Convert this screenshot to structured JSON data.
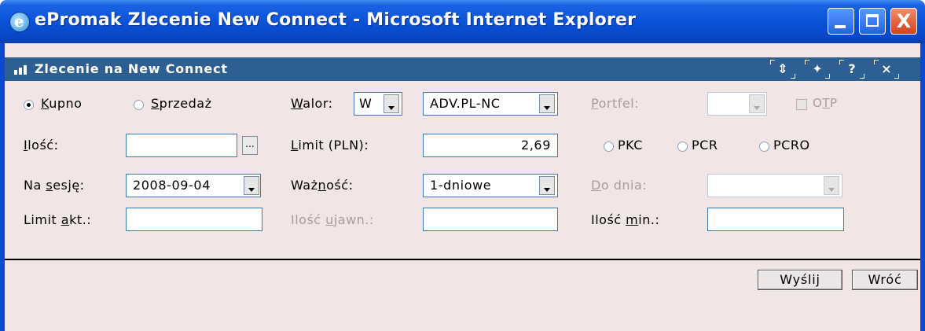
{
  "window": {
    "title": "ePromak Zlecenie New Connect - Microsoft Internet Explorer",
    "icon": "ie-icon",
    "controls": [
      "minimize-icon",
      "maximize-icon",
      "close-icon"
    ],
    "close_glyph": "X",
    "titlebar_color": "#0a52d8"
  },
  "panel": {
    "title": "Zlecenie na New Connect",
    "header_color": "#2d5f92",
    "background": "#f1e5e5",
    "header_buttons": [
      "⇕",
      "✦",
      "?",
      "×"
    ],
    "header_button_icons": [
      "resize-icon",
      "pin-icon",
      "help-icon",
      "close-icon"
    ]
  },
  "order": {
    "side_options": [
      {
        "pre": "",
        "key": "K",
        "post": "upno",
        "selected": true
      },
      {
        "pre": "",
        "key": "S",
        "post": "przedaż",
        "selected": false
      }
    ],
    "walor": {
      "label_key": "W",
      "label_rest": "alor:",
      "type_value": "W",
      "instrument": "ADV.PL-NC"
    },
    "portfel": {
      "label_key": "P",
      "label_rest": "ortfel:",
      "value": "",
      "disabled": true
    },
    "otp": {
      "pre": "O",
      "key": "T",
      "post": "P",
      "checked": false,
      "disabled": true
    },
    "ilosc": {
      "label_key": "I",
      "label_rest": "lość:",
      "value": ""
    },
    "ellipsis": "...",
    "limit": {
      "label_key": "L",
      "label_rest": "imit (PLN):",
      "value": "2,69"
    },
    "limit_types": [
      "PKC",
      "PCR",
      "PCRO"
    ],
    "na_sesje": {
      "label_pre": "Na ",
      "label_key": "s",
      "label_rest": "esję:",
      "value": "2008-09-04"
    },
    "waznosc": {
      "label_pre": "Waż",
      "label_key": "n",
      "label_rest": "ość:",
      "value": "1-dniowe"
    },
    "do_dnia": {
      "label_key": "D",
      "label_rest": "o dnia:",
      "value": "",
      "disabled": true
    },
    "limit_akt": {
      "label_pre": "Limit ",
      "label_key": "a",
      "label_rest": "kt.:",
      "value": ""
    },
    "ilosc_ujawn": {
      "label_pre": "Ilość ",
      "label_key": "u",
      "label_rest": "jawn.:",
      "value": "",
      "disabled": true
    },
    "ilosc_min": {
      "label_pre": "Ilość ",
      "label_key": "m",
      "label_rest": "in.:",
      "value": ""
    }
  },
  "buttons": {
    "send": "Wyślij",
    "back": "Wróć"
  }
}
